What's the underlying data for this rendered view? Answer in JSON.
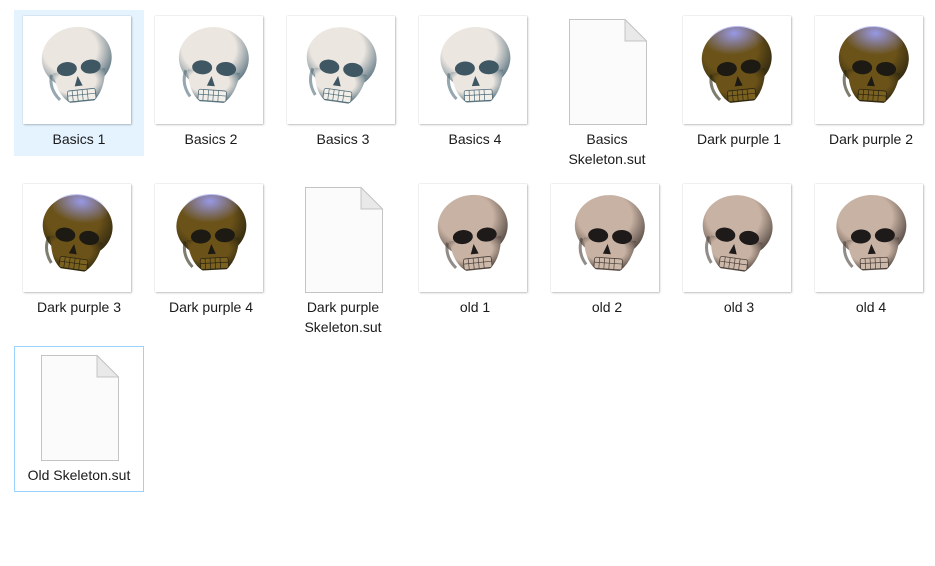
{
  "files": [
    {
      "name": "Basics 1",
      "kind": "image",
      "palette": "basics",
      "skull_style": 1,
      "selected": true
    },
    {
      "name": "Basics 2",
      "kind": "image",
      "palette": "basics",
      "skull_style": 2
    },
    {
      "name": "Basics 3",
      "kind": "image",
      "palette": "basics",
      "skull_style": 3
    },
    {
      "name": "Basics 4",
      "kind": "image",
      "palette": "basics",
      "skull_style": 4
    },
    {
      "name_line1": "Basics",
      "name_line2": "Skeleton.sut",
      "kind": "document"
    },
    {
      "name": "Dark purple 1",
      "kind": "image",
      "palette": "dark_purple",
      "skull_style": 1
    },
    {
      "name": "Dark purple 2",
      "kind": "image",
      "palette": "dark_purple",
      "skull_style": 2
    },
    {
      "name": "Dark purple 3",
      "kind": "image",
      "palette": "dark_purple",
      "skull_style": 3
    },
    {
      "name": "Dark purple 4",
      "kind": "image",
      "palette": "dark_purple",
      "skull_style": 4
    },
    {
      "name_line1": "Dark purple",
      "name_line2": "Skeleton.sut",
      "kind": "document"
    },
    {
      "name": "old 1",
      "kind": "image",
      "palette": "old",
      "skull_style": 1
    },
    {
      "name": "old 2",
      "kind": "image",
      "palette": "old",
      "skull_style": 2
    },
    {
      "name": "old 3",
      "kind": "image",
      "palette": "old",
      "skull_style": 3
    },
    {
      "name": "old 4",
      "kind": "image",
      "palette": "old",
      "skull_style": 4
    },
    {
      "name": "Old Skeleton.sut",
      "kind": "document",
      "focused": true
    }
  ],
  "palettes": {
    "basics": {
      "bone": "#ece6e0",
      "shade": "#4e6a78",
      "socket": "#3f5663",
      "teeth": "#f2efe9",
      "cap": "#ece6e0"
    },
    "dark_purple": {
      "bone": "#6b5218",
      "shade": "#2a2410",
      "socket": "#1c1a12",
      "teeth": "#7a6120",
      "cap": "#9a9cf0"
    },
    "old": {
      "bone": "#c8b2a3",
      "shade": "#4a3f3a",
      "socket": "#1e1a1a",
      "teeth": "#cdb9aa",
      "cap": "#c8b2a3"
    }
  },
  "colors": {
    "selection_bg": "#e5f3ff",
    "focus_border": "#99d1ff",
    "label_text": "#1a1a1a"
  }
}
